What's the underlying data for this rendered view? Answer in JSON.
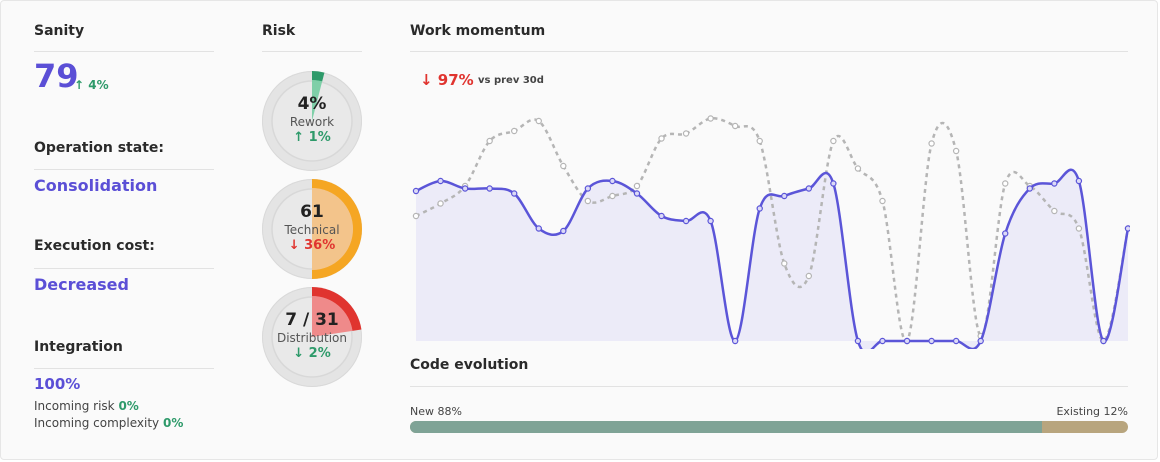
{
  "sanity": {
    "title": "Sanity",
    "score": "79",
    "delta": "↑ 4%"
  },
  "operation": {
    "title": "Operation state:",
    "value": "Consolidation"
  },
  "execution": {
    "title": "Execution cost:",
    "value": "Decreased"
  },
  "integration": {
    "title": "Integration",
    "value": "100%",
    "risk_label": "Incoming risk",
    "risk_value": "0%",
    "complexity_label": "Incoming complexity",
    "complexity_value": "0%"
  },
  "risk": {
    "title": "Risk",
    "rework": {
      "value": "4%",
      "label": "Rework",
      "delta": "↑ 1%",
      "fill_fraction": 0.04,
      "color": "#2e9a6a",
      "fill_color": "#7fcfa8"
    },
    "technical": {
      "value": "61",
      "label": "Technical",
      "delta": "↓ 36%",
      "fill_fraction": 0.5,
      "color": "#f5a623",
      "fill_color": "#f3c48b"
    },
    "distribution": {
      "value": "7 / 31",
      "label": "Distribution",
      "delta": "↓ 2%",
      "fill_fraction": 0.226,
      "color": "#e0342f",
      "fill_color": "#ef8a8a"
    }
  },
  "momentum": {
    "title": "Work momentum",
    "change": "↓ 97%",
    "compare_label": "vs prev 30d"
  },
  "chart_data": {
    "type": "line",
    "title": "Work momentum",
    "x": [
      0,
      1,
      2,
      3,
      4,
      5,
      6,
      7,
      8,
      9,
      10,
      11,
      12,
      13,
      14,
      15,
      16,
      17,
      18,
      19,
      20,
      21,
      22,
      23,
      24,
      25,
      26,
      27,
      28,
      29
    ],
    "ylim": [
      0,
      100
    ],
    "series": [
      {
        "style": "dashed",
        "color": "#b5b5b5",
        "values": [
          50,
          55,
          62,
          80,
          84,
          88,
          70,
          56,
          58,
          62,
          81,
          83,
          89,
          86,
          80,
          31,
          26,
          80,
          69,
          56,
          0,
          79,
          76,
          2,
          63,
          62,
          52,
          45,
          0,
          45
        ]
      },
      {
        "style": "solid",
        "color": "#5b55d8",
        "fill": "#ecebf8",
        "values": [
          60,
          64,
          61,
          61,
          59,
          45,
          44,
          61,
          64,
          59,
          50,
          48,
          48,
          0,
          53,
          58,
          61,
          63,
          0,
          0,
          0,
          0,
          0,
          0,
          43,
          61,
          63,
          64,
          0,
          45
        ]
      }
    ]
  },
  "code_evolution": {
    "title": "Code evolution",
    "new_label": "New 88%",
    "existing_label": "Existing 12%",
    "new_fraction": 0.88
  }
}
